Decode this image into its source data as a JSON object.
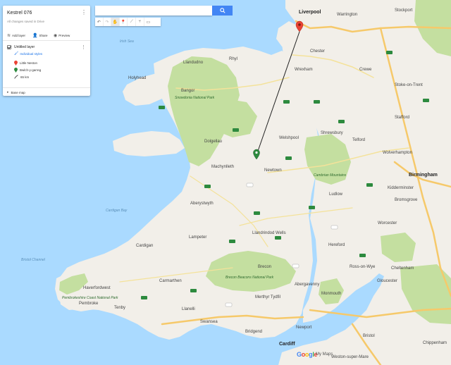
{
  "map": {
    "cities": [
      {
        "name": "Liverpool",
        "big": true
      },
      {
        "name": "Warrington"
      },
      {
        "name": "Stockport"
      },
      {
        "name": "Chester"
      },
      {
        "name": "Wrexham"
      },
      {
        "name": "Bangor"
      },
      {
        "name": "Holyhead"
      },
      {
        "name": "Shrewsbury"
      },
      {
        "name": "Telford"
      },
      {
        "name": "Stoke-on-Trent"
      },
      {
        "name": "Crewe"
      },
      {
        "name": "Stafford"
      },
      {
        "name": "Wolverhampton"
      },
      {
        "name": "Birmingham",
        "big": true
      },
      {
        "name": "Aberystwyth"
      },
      {
        "name": "Newtown"
      },
      {
        "name": "Llandrindod Wells"
      },
      {
        "name": "Hereford"
      },
      {
        "name": "Worcester"
      },
      {
        "name": "Carmarthen"
      },
      {
        "name": "Swansea"
      },
      {
        "name": "Cardiff",
        "big": true
      },
      {
        "name": "Newport"
      },
      {
        "name": "Gloucester"
      },
      {
        "name": "Cheltenham"
      },
      {
        "name": "Bristol"
      },
      {
        "name": "Haverfordwest"
      },
      {
        "name": "Pembroke"
      },
      {
        "name": "Tenby"
      },
      {
        "name": "Brecon"
      },
      {
        "name": "Merthyr Tydfil"
      },
      {
        "name": "Abergavenny"
      },
      {
        "name": "Machynlleth"
      },
      {
        "name": "Dolgellau"
      },
      {
        "name": "Welshpool"
      },
      {
        "name": "Llanelli"
      },
      {
        "name": "Bridgend"
      },
      {
        "name": "Ludlow"
      },
      {
        "name": "Kidderminster"
      },
      {
        "name": "Bromsgrove"
      },
      {
        "name": "Chippenham"
      },
      {
        "name": "Weston-super-Mare"
      },
      {
        "name": "Llandudno"
      },
      {
        "name": "Rhyl"
      },
      {
        "name": "Lampeter"
      },
      {
        "name": "Cardigan"
      },
      {
        "name": "Ross-on-Wye"
      },
      {
        "name": "Monmouth"
      }
    ],
    "parks": [
      "Snowdonia National Park",
      "Brecon Beacons National Park",
      "Pembrokeshire Coast National Park",
      "Cambrian Mountains"
    ],
    "seas": [
      "Cardigan Bay",
      "Bristol Channel",
      "Irish Sea"
    ],
    "colors": {
      "sea": "#aadaff",
      "land": "#f2efe9",
      "park": "#c4dfa0",
      "motorway": "#f6c96a",
      "route_line": "#222222",
      "marker_red": "#ea4335",
      "marker_green": "#2d8a3e"
    }
  },
  "panel": {
    "title": "Kestrel 076",
    "subtitle": "All changes saved in Drive",
    "menu_icon": "more-vert-icon",
    "actions": {
      "add_layer": "Add layer",
      "share": "Share",
      "preview": "Preview"
    },
    "layer": {
      "name": "Untitled layer",
      "style": "Individual styles",
      "features": [
        {
          "label": "Little Neston",
          "icon": "red-pin-icon"
        },
        {
          "label": "Bwlch-y-garreg",
          "icon": "green-pin-icon"
        },
        {
          "label": "65 km",
          "icon": "line-icon"
        }
      ]
    },
    "base_map": "Base map"
  },
  "search": {
    "placeholder": "",
    "button_icon": "search-icon"
  },
  "toolbar": {
    "tools": [
      "undo-icon",
      "redo-icon",
      "hand-icon",
      "marker-icon",
      "line-icon",
      "route-icon",
      "ruler-icon"
    ]
  },
  "footer": {
    "google": "Google",
    "mymaps": "My Maps"
  }
}
